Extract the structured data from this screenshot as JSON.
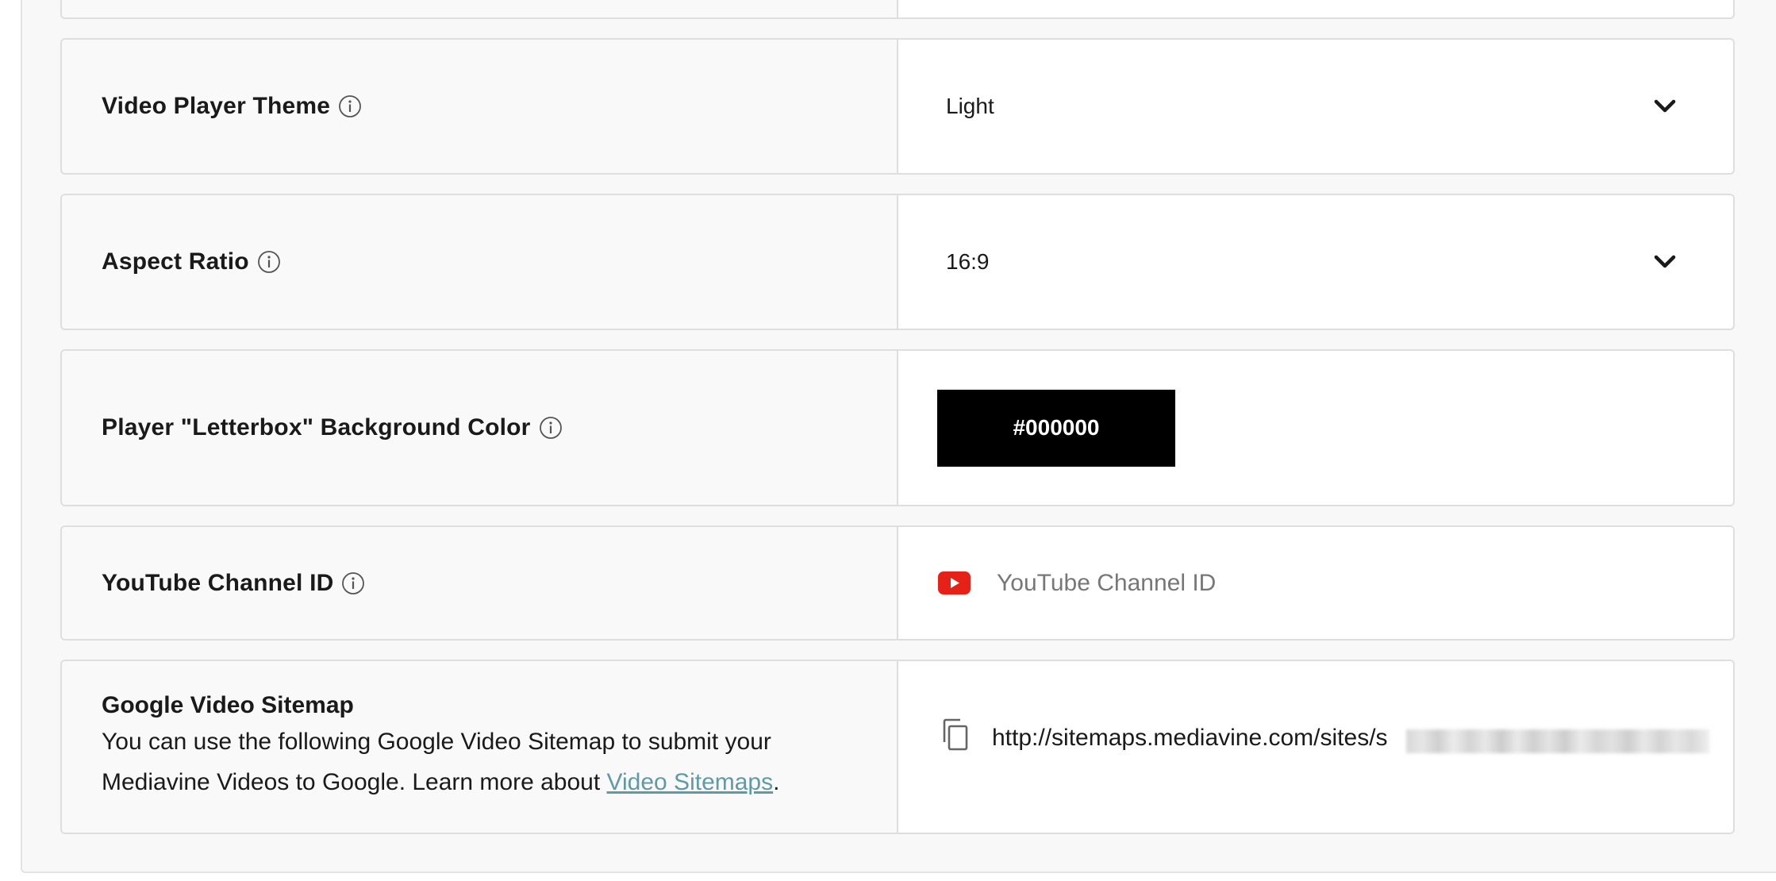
{
  "settings": {
    "video_player_theme": {
      "label": "Video Player Theme",
      "value": "Light"
    },
    "aspect_ratio": {
      "label": "Aspect Ratio",
      "value": "16:9"
    },
    "letterbox_color": {
      "label": "Player \"Letterbox\" Background Color",
      "value": "#000000"
    },
    "youtube_channel": {
      "label": "YouTube Channel ID",
      "placeholder": "YouTube Channel ID",
      "icon": "youtube-icon"
    },
    "sitemap": {
      "title": "Google Video Sitemap",
      "description": "You can use the following Google Video Sitemap to submit your Mediavine Videos to Google. Learn more about ",
      "link_text": "Video Sitemaps",
      "trailing": ".",
      "url": "http://sitemaps.mediavine.com/sites/s",
      "icon": "copy-icon"
    }
  },
  "colors": {
    "link": "#5f9aa6",
    "youtube_red": "#e62117",
    "swatch": "#000000"
  }
}
